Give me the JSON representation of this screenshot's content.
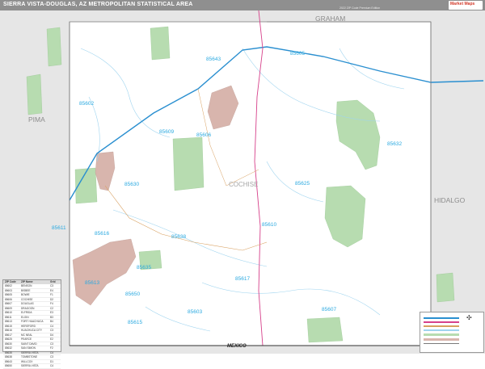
{
  "header": {
    "title": "SIERRA VISTA-DOUGLAS, AZ METROPOLITAN STATISTICAL AREA",
    "edition": "2022 ZIP Code Premium Edition",
    "logo_text": "Market Maps"
  },
  "counties": {
    "graham": "GRAHAM",
    "pima": "PIMA",
    "hidalgo": "HIDALGO",
    "cochise": "COCHISE"
  },
  "country": {
    "mexico": "MEXICO"
  },
  "zip_labels": {
    "z85643": "85643",
    "z85605": "85605",
    "z85602": "85602",
    "z85609": "85609",
    "z85606": "85606",
    "z85632": "85632",
    "z85630": "85630",
    "z85625": "85625",
    "z85610": "85610",
    "z85611": "85611",
    "z85616": "85616",
    "z85638": "85638",
    "z85635": "85635",
    "z85613": "85613",
    "z85650": "85650",
    "z85617": "85617",
    "z85603": "85603",
    "z85607": "85607",
    "z85615": "85615"
  },
  "legend": {
    "headers": [
      "ZIP Code",
      "ZIP Name",
      "Grid"
    ],
    "rows": [
      [
        "85602",
        "BENSON",
        "C3"
      ],
      [
        "85603",
        "BISBEE",
        "E4"
      ],
      [
        "85605",
        "BOWIE",
        "F1"
      ],
      [
        "85606",
        "COCHISE",
        "D2"
      ],
      [
        "85607",
        "DOUGLAS",
        "F4"
      ],
      [
        "85609",
        "DRAGOON",
        "C2"
      ],
      [
        "85610",
        "ELFRIDA",
        "E3"
      ],
      [
        "85611",
        "ELGIN",
        "B3"
      ],
      [
        "85613",
        "FORT HUACHUCA",
        "B4"
      ],
      [
        "85615",
        "HEREFORD",
        "C4"
      ],
      [
        "85616",
        "HUACHUCA CITY",
        "C3"
      ],
      [
        "85617",
        "MC NEAL",
        "D4"
      ],
      [
        "85625",
        "PEARCE",
        "E2"
      ],
      [
        "85630",
        "SAINT DAVID",
        "C3"
      ],
      [
        "85632",
        "SAN SIMON",
        "F2"
      ],
      [
        "85635",
        "SIERRA VISTA",
        "C4"
      ],
      [
        "85638",
        "TOMBSTONE",
        "C3"
      ],
      [
        "85643",
        "WILLCOX",
        "D1"
      ],
      [
        "85650",
        "SIERRA VISTA",
        "C4"
      ]
    ]
  },
  "colors": {
    "title_bar": "#8f8f8f",
    "zip_label": "#2aa9e0",
    "county_outside": "#e6e6e6",
    "national_forest": "#b7dcb0",
    "urban": "#d8b5ad",
    "interstate": "#2a8fd0",
    "highway": "#d6408a",
    "water": "#9fd4ef"
  },
  "icons": {
    "compass": "compass-icon"
  }
}
